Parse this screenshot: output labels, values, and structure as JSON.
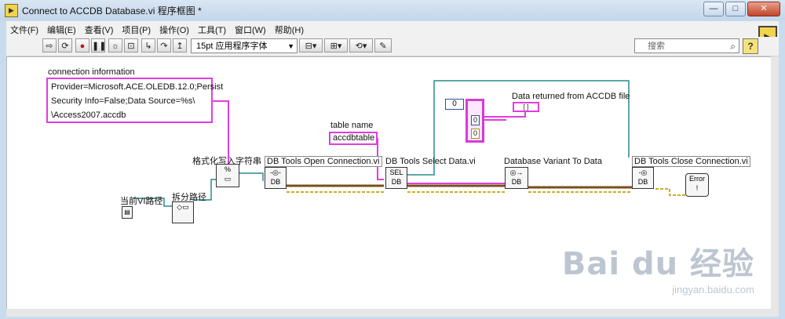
{
  "window": {
    "title": "Connect to ACCDB Database.vi 程序框图 *",
    "minimize_glyph": "—",
    "restore_glyph": "□",
    "close_glyph": "✕"
  },
  "menu": [
    "文件(F)",
    "编辑(E)",
    "查看(V)",
    "项目(P)",
    "操作(O)",
    "工具(T)",
    "窗口(W)",
    "帮助(H)"
  ],
  "toolbar": {
    "font": "15pt 应用程序字体",
    "search_placeholder": "搜索",
    "help": "?"
  },
  "diagram": {
    "connection_label": "connection information",
    "connection_lines": [
      "Provider=Microsoft.ACE.OLEDB.12.0;Persist",
      "Security Info=False;Data Source=%s\\",
      "\\Access2007.accdb"
    ],
    "format_label": "格式化写入字符串",
    "current_vi_path_label": "当前VI路径",
    "strip_path_label": "拆分路径",
    "table_name_label": "table name",
    "table_name_value": "accdbtable",
    "open_conn_label": "DB Tools Open Connection.vi",
    "select_label": "DB Tools Select Data.vi",
    "variant_label": "Database Variant To Data",
    "close_label": "DB Tools Close Connection.vi",
    "data_returned_label": "Data returned from ACCDB file",
    "zero_const": "0",
    "cluster_vals": [
      "0",
      "0"
    ],
    "error_label": "Error"
  },
  "watermark": {
    "logo": "Bai du 经验",
    "url": "jingyan.baidu.com"
  }
}
